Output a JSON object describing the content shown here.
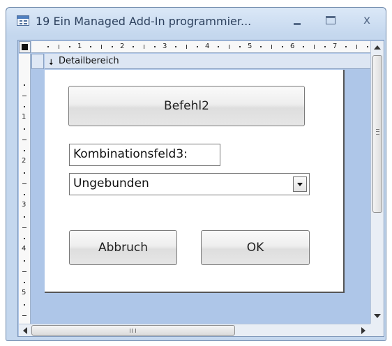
{
  "window": {
    "title": "19 Ein Managed Add-In programmier...",
    "icon": "access-form-icon",
    "controls": {
      "minimize": "–",
      "maximize": "□",
      "close": "x"
    }
  },
  "ruler": {
    "horizontal_numbers": [
      "1",
      "2",
      "3",
      "4",
      "5",
      "6",
      "7"
    ],
    "vertical_numbers": [
      "1",
      "2",
      "3",
      "4",
      "5"
    ]
  },
  "section": {
    "icon": "section-arrow-icon",
    "label": "Detailbereich"
  },
  "form": {
    "command_button_label": "Befehl2",
    "combo_label": "Kombinationsfeld3:",
    "combo_value": "Ungebunden",
    "cancel_button_label": "Abbruch",
    "ok_button_label": "OK"
  },
  "colors": {
    "window_frame": "#c4d7ee",
    "design_background": "#aec6e8",
    "form_background": "#ffffff"
  }
}
